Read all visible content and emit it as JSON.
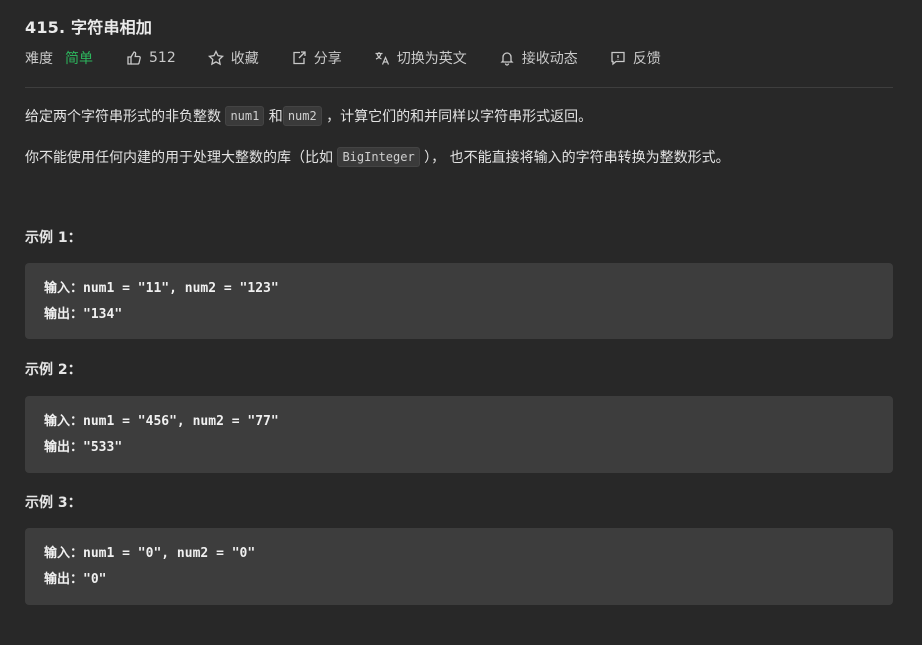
{
  "problem": {
    "title": "415. 字符串相加",
    "difficulty_label": "难度",
    "difficulty": "简单"
  },
  "meta": {
    "likes": "512",
    "favorite": "收藏",
    "share": "分享",
    "switch_lang": "切换为英文",
    "subscribe": "接收动态",
    "feedback": "反馈"
  },
  "description": {
    "p1_before": "给定两个字符串形式的非负整数 ",
    "code_num1": "num1",
    "p1_mid": " 和",
    "code_num2": "num2",
    "p1_after": " ，计算它们的和并同样以字符串形式返回。",
    "p2_before": "你不能使用任何内建的用于处理大整数的库（比如 ",
    "code_biginteger": "BigInteger",
    "p2_after": " ）， 也不能直接将输入的字符串转换为整数形式。"
  },
  "examples": [
    {
      "title": "示例 1：",
      "input_label": "输入：",
      "input": "num1 = \"11\", num2 = \"123\"",
      "output_label": "输出：",
      "output": "\"134\""
    },
    {
      "title": "示例 2：",
      "input_label": "输入：",
      "input": "num1 = \"456\", num2 = \"77\"",
      "output_label": "输出：",
      "output": "\"533\""
    },
    {
      "title": "示例 3：",
      "input_label": "输入：",
      "input": "num1 = \"0\", num2 = \"0\"",
      "output_label": "输出：",
      "output": "\"0\""
    }
  ],
  "colors": {
    "background": "#282828",
    "difficulty_easy": "#2db55d",
    "example_box": "#3d3d3d"
  },
  "icons": {
    "likes": "thumbs-up-icon",
    "favorite": "star-icon",
    "share": "share-icon",
    "switch_lang": "translate-icon",
    "subscribe": "bell-icon",
    "feedback": "feedback-icon"
  }
}
